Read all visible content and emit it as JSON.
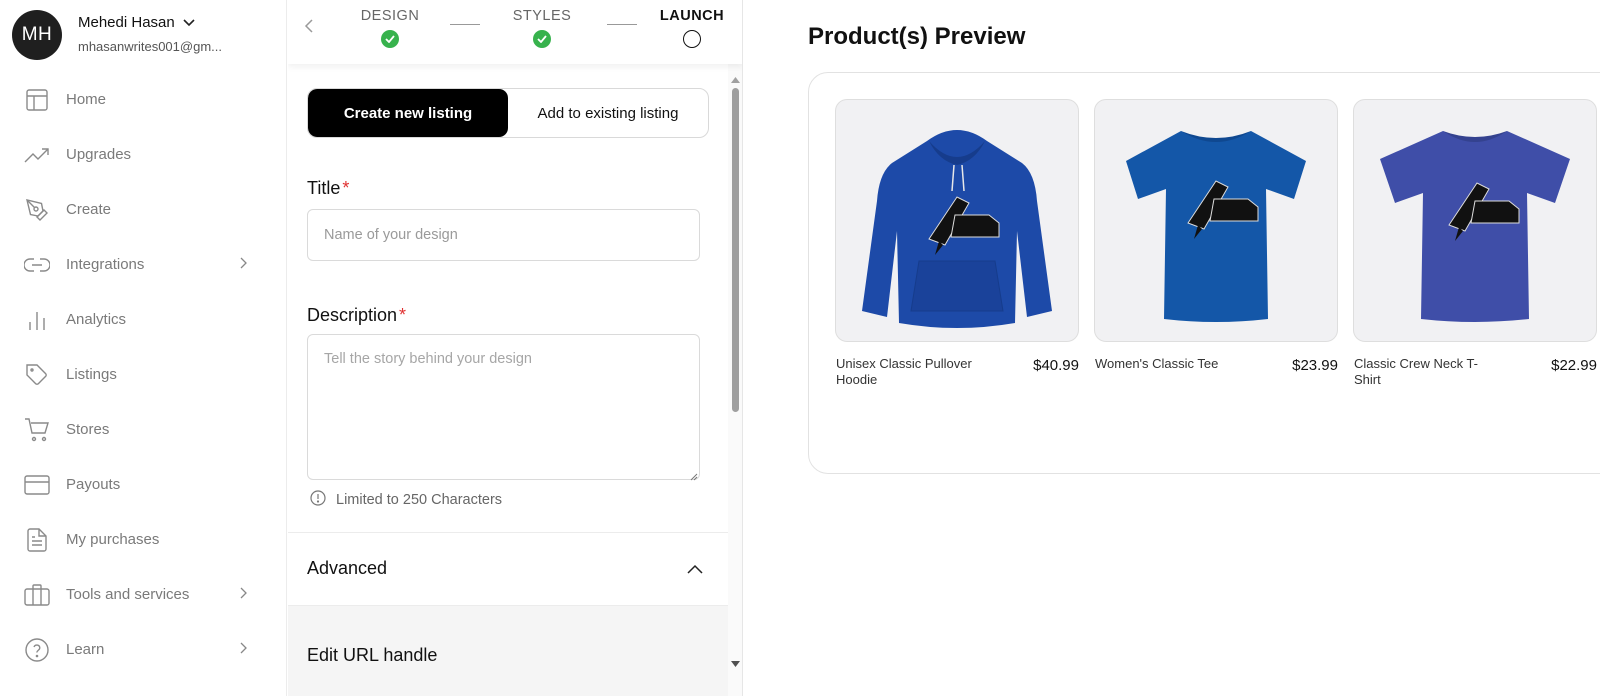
{
  "profile": {
    "initials": "MH",
    "name": "Mehedi Hasan",
    "email": "mhasanwrites001@gm..."
  },
  "nav": {
    "items": [
      {
        "label": "Home",
        "icon": "layout-icon",
        "chevron": false
      },
      {
        "label": "Upgrades",
        "icon": "trending-up-icon",
        "chevron": false
      },
      {
        "label": "Create",
        "icon": "pen-tool-icon",
        "chevron": false
      },
      {
        "label": "Integrations",
        "icon": "link-icon",
        "chevron": true
      },
      {
        "label": "Analytics",
        "icon": "bar-chart-icon",
        "chevron": false
      },
      {
        "label": "Listings",
        "icon": "tag-icon",
        "chevron": false
      },
      {
        "label": "Stores",
        "icon": "cart-icon",
        "chevron": false
      },
      {
        "label": "Payouts",
        "icon": "credit-card-icon",
        "chevron": false
      },
      {
        "label": "My purchases",
        "icon": "document-icon",
        "chevron": false
      },
      {
        "label": "Tools and services",
        "icon": "briefcase-icon",
        "chevron": true
      },
      {
        "label": "Learn",
        "icon": "help-circle-icon",
        "chevron": true
      }
    ]
  },
  "stepper": {
    "steps": [
      {
        "label": "DESIGN",
        "status": "done"
      },
      {
        "label": "STYLES",
        "status": "done"
      },
      {
        "label": "LAUNCH",
        "status": "current"
      }
    ]
  },
  "listing_toggle": {
    "create_label": "Create new listing",
    "existing_label": "Add to existing listing",
    "selected": "create"
  },
  "form": {
    "title_label": "Title",
    "title_required": "*",
    "title_value": "",
    "title_placeholder": "Name of your design",
    "description_label": "Description",
    "description_required": "*",
    "description_value": "",
    "description_placeholder": "Tell the story behind your design",
    "description_hint": "Limited to 250 Characters",
    "advanced_label": "Advanced",
    "edit_url_label": "Edit URL handle"
  },
  "preview": {
    "title": "Product(s) Preview",
    "products": [
      {
        "name": "Unisex Classic Pullover Hoodie",
        "price": "$40.99",
        "type": "hoodie",
        "color": "#1d4aa8"
      },
      {
        "name": "Women's Classic Tee",
        "price": "$23.99",
        "type": "tee",
        "color": "#1457a8"
      },
      {
        "name": "Classic Crew Neck T-Shirt",
        "price": "$22.99",
        "type": "tee",
        "color": "#3f4ea8"
      }
    ]
  },
  "colors": {
    "check_green": "#37b24d",
    "required_red": "#e03131",
    "selected_toggle": "#000000"
  }
}
